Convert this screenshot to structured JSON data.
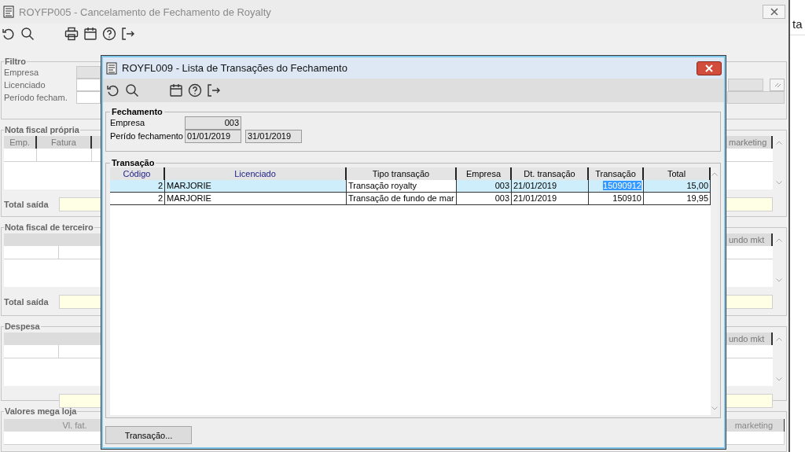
{
  "main_window": {
    "title": "ROYFP005 - Cancelamento de Fechamento de Royalty"
  },
  "filter": {
    "title": "Filtro",
    "labels": [
      "Empresa",
      "Licenciado",
      "Período fecham."
    ]
  },
  "nf_propria": {
    "title": "Nota fiscal própria",
    "columns": [
      "Emp.",
      "Fatura"
    ],
    "right_column": "marketing",
    "total_label": "Total saída"
  },
  "nf_terceiro": {
    "title": "Nota fiscal de terceiro",
    "right_column": "undo mkt",
    "total_label": "Total saída"
  },
  "despesa": {
    "title": "Despesa",
    "right_column": "undo mkt"
  },
  "valores_mega_loja": {
    "title": "Valores mega loja",
    "first_column": "Vl. fat.",
    "right_column": "marketing"
  },
  "side_window": {
    "text": "ta"
  },
  "dialog": {
    "title": "ROYFL009 - Lista de Transações do Fechamento",
    "fechamento": {
      "title": "Fechamento",
      "empresa_label": "Empresa",
      "empresa": "003",
      "periodo_label": "Perído fechamento",
      "periodo_inicio": "01/01/2019",
      "periodo_fim": "31/01/2019"
    },
    "transacao": {
      "title": "Transação",
      "columns": [
        {
          "label": "Código",
          "sortable": true
        },
        {
          "label": "Licenciado",
          "sortable": true
        },
        {
          "label": "Tipo transação",
          "sortable": false
        },
        {
          "label": "Empresa",
          "sortable": false
        },
        {
          "label": "Dt. transação",
          "sortable": false
        },
        {
          "label": "Transação",
          "sortable": false
        },
        {
          "label": "Total",
          "sortable": false
        }
      ],
      "rows": [
        {
          "codigo": "2",
          "licenciado": "MARJORIE",
          "tipo": "Transação royalty",
          "empresa": "003",
          "data": "21/01/2019",
          "transacao": "15090912",
          "total": "15,00",
          "selected": true
        },
        {
          "codigo": "2",
          "licenciado": "MARJORIE",
          "tipo": "Transação de fundo de mar",
          "empresa": "003",
          "data": "21/01/2019",
          "transacao": "150910",
          "total": "19,95",
          "selected": false
        }
      ]
    },
    "button": "Transação..."
  }
}
